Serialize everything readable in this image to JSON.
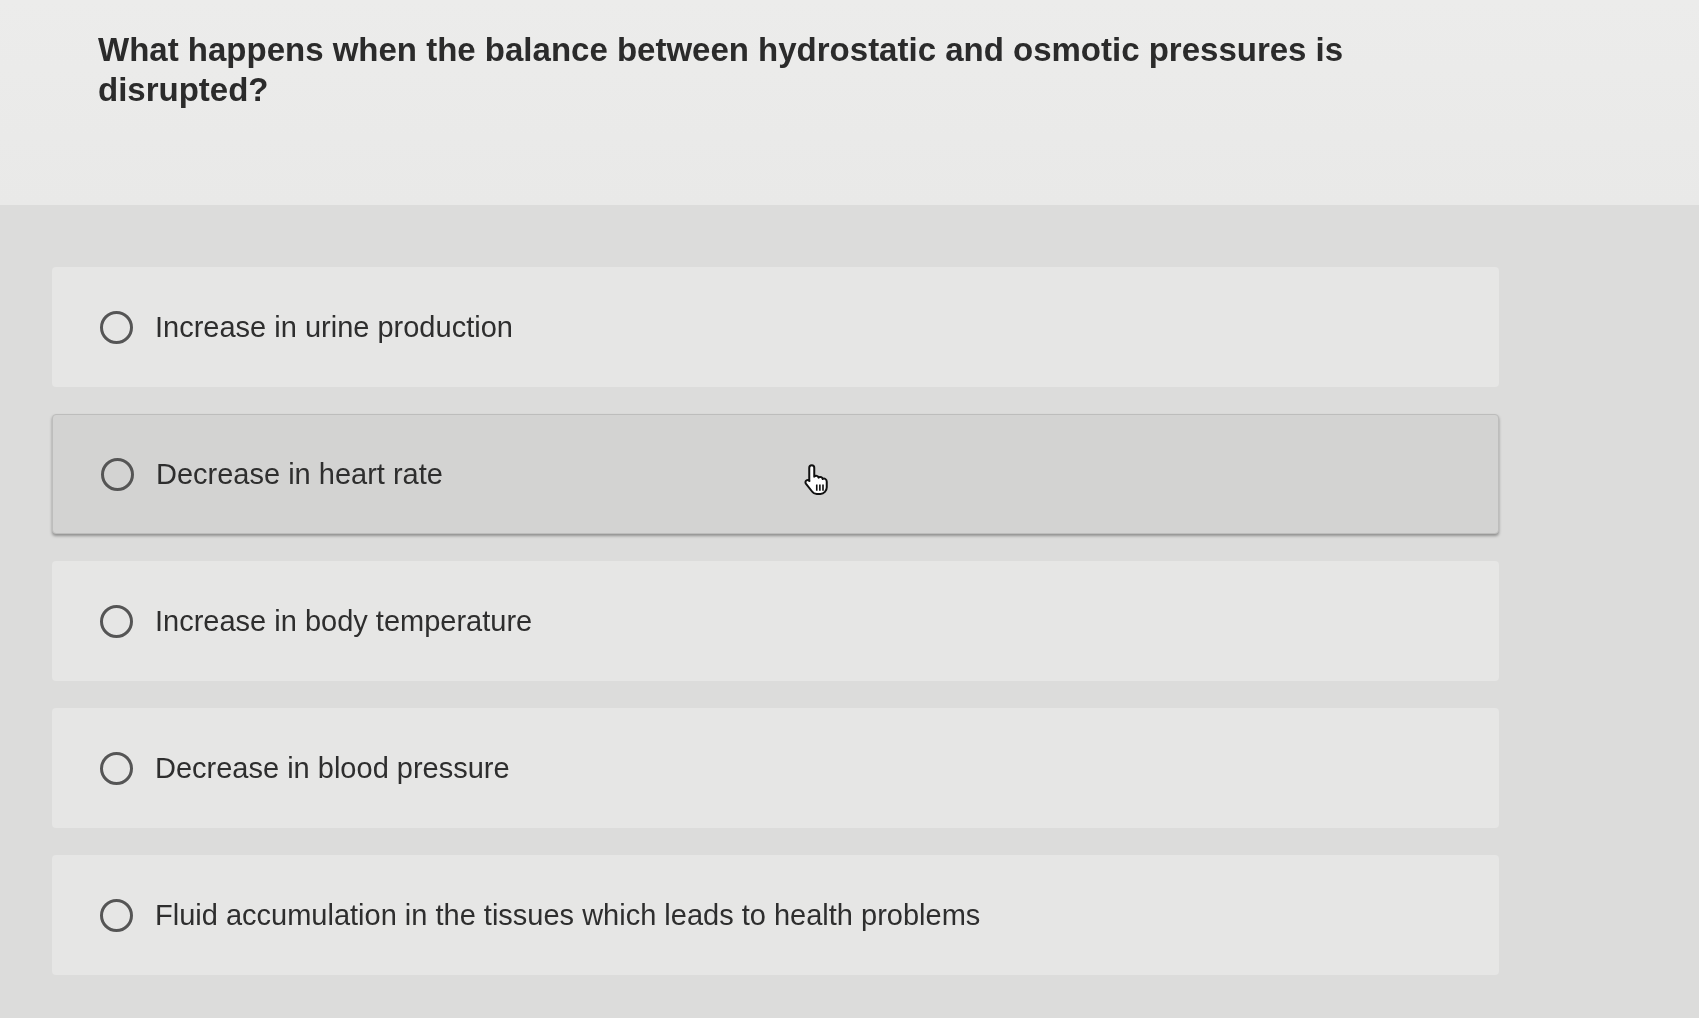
{
  "question": {
    "text": "What happens when the balance between hydrostatic and osmotic pressures is disrupted?"
  },
  "options": [
    {
      "label": "Increase in urine production",
      "selected": false,
      "hovered": false
    },
    {
      "label": "Decrease in heart rate",
      "selected": false,
      "hovered": true
    },
    {
      "label": "Increase in body temperature",
      "selected": false,
      "hovered": false
    },
    {
      "label": "Decrease in blood pressure",
      "selected": false,
      "hovered": false
    },
    {
      "label": "Fluid accumulation in the tissues which leads to health problems",
      "selected": false,
      "hovered": false
    }
  ]
}
